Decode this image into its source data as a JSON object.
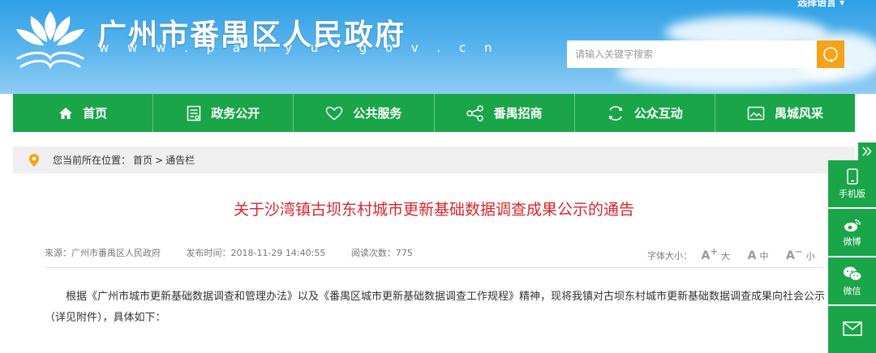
{
  "header": {
    "title": "广州市番禺区人民政府",
    "url": "w w w . p a n y u . g o v . c n",
    "language_label": "选择语言 ▾",
    "search_placeholder": "请输入关键字搜索"
  },
  "nav": {
    "items": [
      {
        "label": "首页",
        "icon": "home-icon"
      },
      {
        "label": "政务公开",
        "icon": "document-icon"
      },
      {
        "label": "公共服务",
        "icon": "heart-icon"
      },
      {
        "label": "番禺招商",
        "icon": "share-icon"
      },
      {
        "label": "公众互动",
        "icon": "refresh-icon"
      },
      {
        "label": "禺城风采",
        "icon": "image-icon"
      }
    ]
  },
  "breadcrumb": {
    "prefix": "您当前所在位置：",
    "home": "首页",
    "separator": ">",
    "current": "通告栏"
  },
  "article": {
    "title": "关于沙湾镇古坝东村城市更新基础数据调查成果公示的通告",
    "source": "来源：广州市番禺区人民政府",
    "publish_time": "发布时间：2018-11-29 14:40:55",
    "read_count": "阅读次数：775",
    "font_size_label": "字体大小：",
    "font_large": "大",
    "font_medium": "中",
    "font_small": "小",
    "body": "根据《广州市城市更新基础数据调查和管理办法》以及《番禺区城市更新基础数据调查工作规程》精神，现将我镇对古坝东村城市更新基础数据调查成果向社会公示（详见附件），具体如下："
  },
  "sidebar": {
    "items": [
      {
        "label": "手机版",
        "icon": "mobile-icon"
      },
      {
        "label": "微博",
        "icon": "weibo-icon"
      },
      {
        "label": "微信",
        "icon": "wechat-icon"
      },
      {
        "label": "",
        "icon": "mail-icon"
      }
    ]
  },
  "colors": {
    "nav_green": "#1aa548",
    "header_blue": "#2f9fe6",
    "title_red": "#d7262c",
    "search_orange": "#f5a319"
  }
}
